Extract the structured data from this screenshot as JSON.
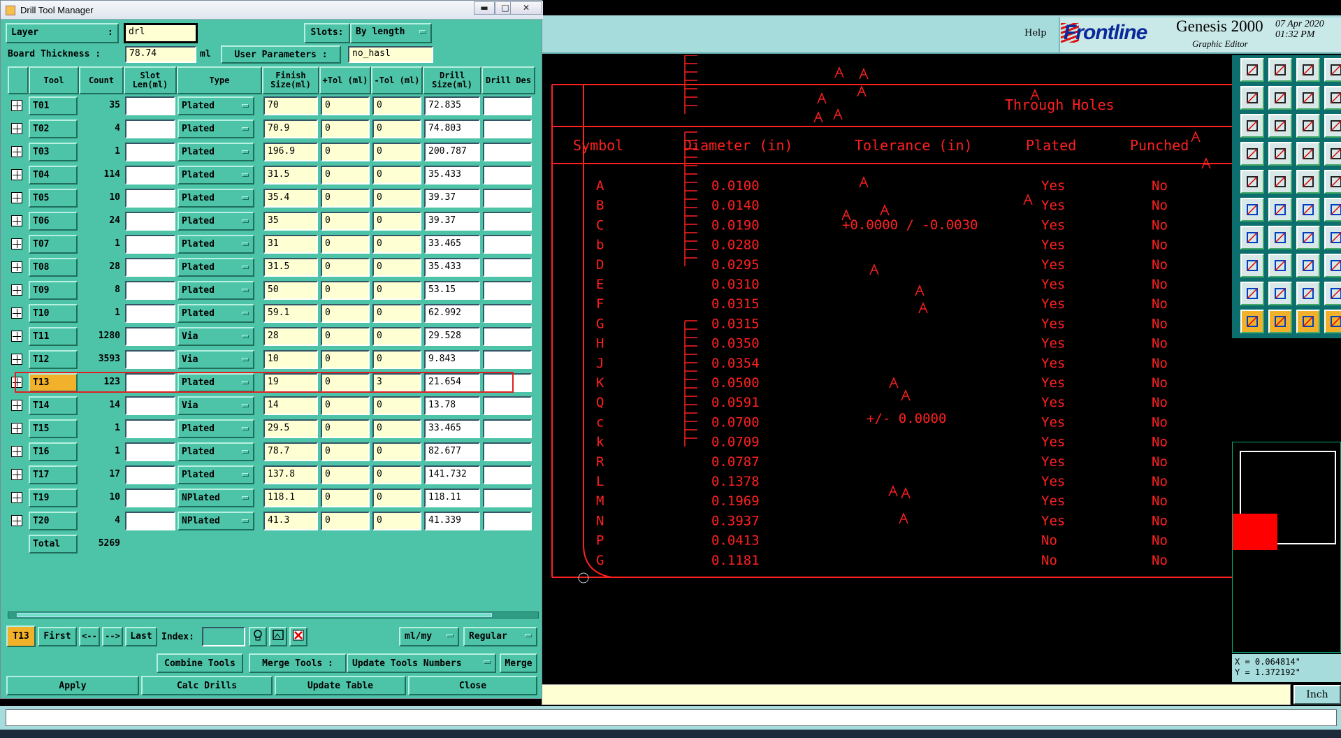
{
  "dialog": {
    "title": "Drill Tool Manager",
    "window_buttons": {
      "minimize": "▬",
      "maximize": "□",
      "close": "✕"
    },
    "layer_label": "Layer",
    "layer_colon": ":",
    "layer_value": "drl",
    "slots_label": "Slots:",
    "slots_value": "By length",
    "board_thickness_label": "Board Thickness :",
    "board_thickness_value": "78.74",
    "board_thickness_unit": "ml",
    "user_params_label": "User Parameters :",
    "user_params_value": "no_hasl",
    "columns": [
      "Tool",
      "Count",
      "Slot Len(ml)",
      "Type",
      "Finish Size(ml)",
      "+Tol (ml)",
      "-Tol (ml)",
      "Drill Size(ml)",
      "Drill Des"
    ],
    "rows": [
      {
        "tool": "T01",
        "count": "35",
        "type": "Plated",
        "finish": "70",
        "ptol": "0",
        "ntol": "0",
        "drill": "72.835"
      },
      {
        "tool": "T02",
        "count": "4",
        "type": "Plated",
        "finish": "70.9",
        "ptol": "0",
        "ntol": "0",
        "drill": "74.803"
      },
      {
        "tool": "T03",
        "count": "1",
        "type": "Plated",
        "finish": "196.9",
        "ptol": "0",
        "ntol": "0",
        "drill": "200.787"
      },
      {
        "tool": "T04",
        "count": "114",
        "type": "Plated",
        "finish": "31.5",
        "ptol": "0",
        "ntol": "0",
        "drill": "35.433"
      },
      {
        "tool": "T05",
        "count": "10",
        "type": "Plated",
        "finish": "35.4",
        "ptol": "0",
        "ntol": "0",
        "drill": "39.37"
      },
      {
        "tool": "T06",
        "count": "24",
        "type": "Plated",
        "finish": "35",
        "ptol": "0",
        "ntol": "0",
        "drill": "39.37"
      },
      {
        "tool": "T07",
        "count": "1",
        "type": "Plated",
        "finish": "31",
        "ptol": "0",
        "ntol": "0",
        "drill": "33.465"
      },
      {
        "tool": "T08",
        "count": "28",
        "type": "Plated",
        "finish": "31.5",
        "ptol": "0",
        "ntol": "0",
        "drill": "35.433"
      },
      {
        "tool": "T09",
        "count": "8",
        "type": "Plated",
        "finish": "50",
        "ptol": "0",
        "ntol": "0",
        "drill": "53.15"
      },
      {
        "tool": "T10",
        "count": "1",
        "type": "Plated",
        "finish": "59.1",
        "ptol": "0",
        "ntol": "0",
        "drill": "62.992"
      },
      {
        "tool": "T11",
        "count": "1280",
        "type": "Via",
        "finish": "28",
        "ptol": "0",
        "ntol": "0",
        "drill": "29.528"
      },
      {
        "tool": "T12",
        "count": "3593",
        "type": "Via",
        "finish": "10",
        "ptol": "0",
        "ntol": "0",
        "drill": "9.843"
      },
      {
        "tool": "T13",
        "count": "123",
        "type": "Plated",
        "finish": "19",
        "ptol": "0",
        "ntol": "3",
        "drill": "21.654",
        "selected": true
      },
      {
        "tool": "T14",
        "count": "14",
        "type": "Via",
        "finish": "14",
        "ptol": "0",
        "ntol": "0",
        "drill": "13.78"
      },
      {
        "tool": "T15",
        "count": "1",
        "type": "Plated",
        "finish": "29.5",
        "ptol": "0",
        "ntol": "0",
        "drill": "33.465"
      },
      {
        "tool": "T16",
        "count": "1",
        "type": "Plated",
        "finish": "78.7",
        "ptol": "0",
        "ntol": "0",
        "drill": "82.677"
      },
      {
        "tool": "T17",
        "count": "17",
        "type": "Plated",
        "finish": "137.8",
        "ptol": "0",
        "ntol": "0",
        "drill": "141.732"
      },
      {
        "tool": "T19",
        "count": "10",
        "type": "NPlated",
        "finish": "118.1",
        "ptol": "0",
        "ntol": "0",
        "drill": "118.11"
      },
      {
        "tool": "T20",
        "count": "4",
        "type": "NPlated",
        "finish": "41.3",
        "ptol": "0",
        "ntol": "0",
        "drill": "41.339"
      }
    ],
    "total_label": "Total",
    "total_count": "5269",
    "nav": {
      "current": "T13",
      "first": "First",
      "prev": "<--",
      "next": "-->",
      "last": "Last",
      "index_label": "Index:",
      "units": "ml/my",
      "mode": "Regular"
    },
    "actions": {
      "combine": "Combine Tools",
      "merge_tools_label": "Merge Tools :",
      "update_numbers": "Update Tools Numbers",
      "merge": "Merge"
    },
    "footer": {
      "apply": "Apply",
      "calc": "Calc Drills",
      "update": "Update Table",
      "close": "Close"
    }
  },
  "genesis": {
    "help": "Help",
    "logo": "Frontline",
    "title": "Genesis 2000",
    "subtitle": "Graphic Editor",
    "date": "07 Apr 2020",
    "time": "01:32 PM",
    "coord_x": "X = 0.064814\"",
    "coord_y": "Y = 1.372192\"",
    "units": "Inch"
  },
  "drill_chart": {
    "title": "Through Holes",
    "headers": {
      "symbol": "Symbol",
      "diameter": "Diameter (in)",
      "tolerance": "Tolerance (in)",
      "plated": "Plated",
      "punched": "Punched"
    },
    "tol1": "+0.0000 / -0.0030",
    "tol2": "+/- 0.0000",
    "rows": [
      {
        "sym": "A",
        "dia": "0.0100",
        "pl": "Yes",
        "pu": "No"
      },
      {
        "sym": "B",
        "dia": "0.0140",
        "pl": "Yes",
        "pu": "No"
      },
      {
        "sym": "C",
        "dia": "0.0190",
        "pl": "Yes",
        "pu": "No"
      },
      {
        "sym": "b",
        "dia": "0.0280",
        "pl": "Yes",
        "pu": "No"
      },
      {
        "sym": "D",
        "dia": "0.0295",
        "pl": "Yes",
        "pu": "No"
      },
      {
        "sym": "E",
        "dia": "0.0310",
        "pl": "Yes",
        "pu": "No"
      },
      {
        "sym": "F",
        "dia": "0.0315",
        "pl": "Yes",
        "pu": "No"
      },
      {
        "sym": "G",
        "dia": "0.0315",
        "pl": "Yes",
        "pu": "No"
      },
      {
        "sym": "H",
        "dia": "0.0350",
        "pl": "Yes",
        "pu": "No"
      },
      {
        "sym": "J",
        "dia": "0.0354",
        "pl": "Yes",
        "pu": "No"
      },
      {
        "sym": "K",
        "dia": "0.0500",
        "pl": "Yes",
        "pu": "No"
      },
      {
        "sym": "Q",
        "dia": "0.0591",
        "pl": "Yes",
        "pu": "No"
      },
      {
        "sym": "c",
        "dia": "0.0700",
        "pl": "Yes",
        "pu": "No"
      },
      {
        "sym": "k",
        "dia": "0.0709",
        "pl": "Yes",
        "pu": "No"
      },
      {
        "sym": "R",
        "dia": "0.0787",
        "pl": "Yes",
        "pu": "No"
      },
      {
        "sym": "L",
        "dia": "0.1378",
        "pl": "Yes",
        "pu": "No"
      },
      {
        "sym": "M",
        "dia": "0.1969",
        "pl": "Yes",
        "pu": "No"
      },
      {
        "sym": "N",
        "dia": "0.3937",
        "pl": "Yes",
        "pu": "No"
      },
      {
        "sym": "P",
        "dia": "0.0413",
        "pl": "No",
        "pu": "No"
      },
      {
        "sym": "G",
        "dia": "0.1181",
        "pl": "No",
        "pu": "No"
      }
    ]
  },
  "colors": {
    "dialog_bg": "#4dc4a8",
    "field_bg": "#ffffd4",
    "selected": "#f2b12a",
    "cad_red": "#ff2020"
  }
}
